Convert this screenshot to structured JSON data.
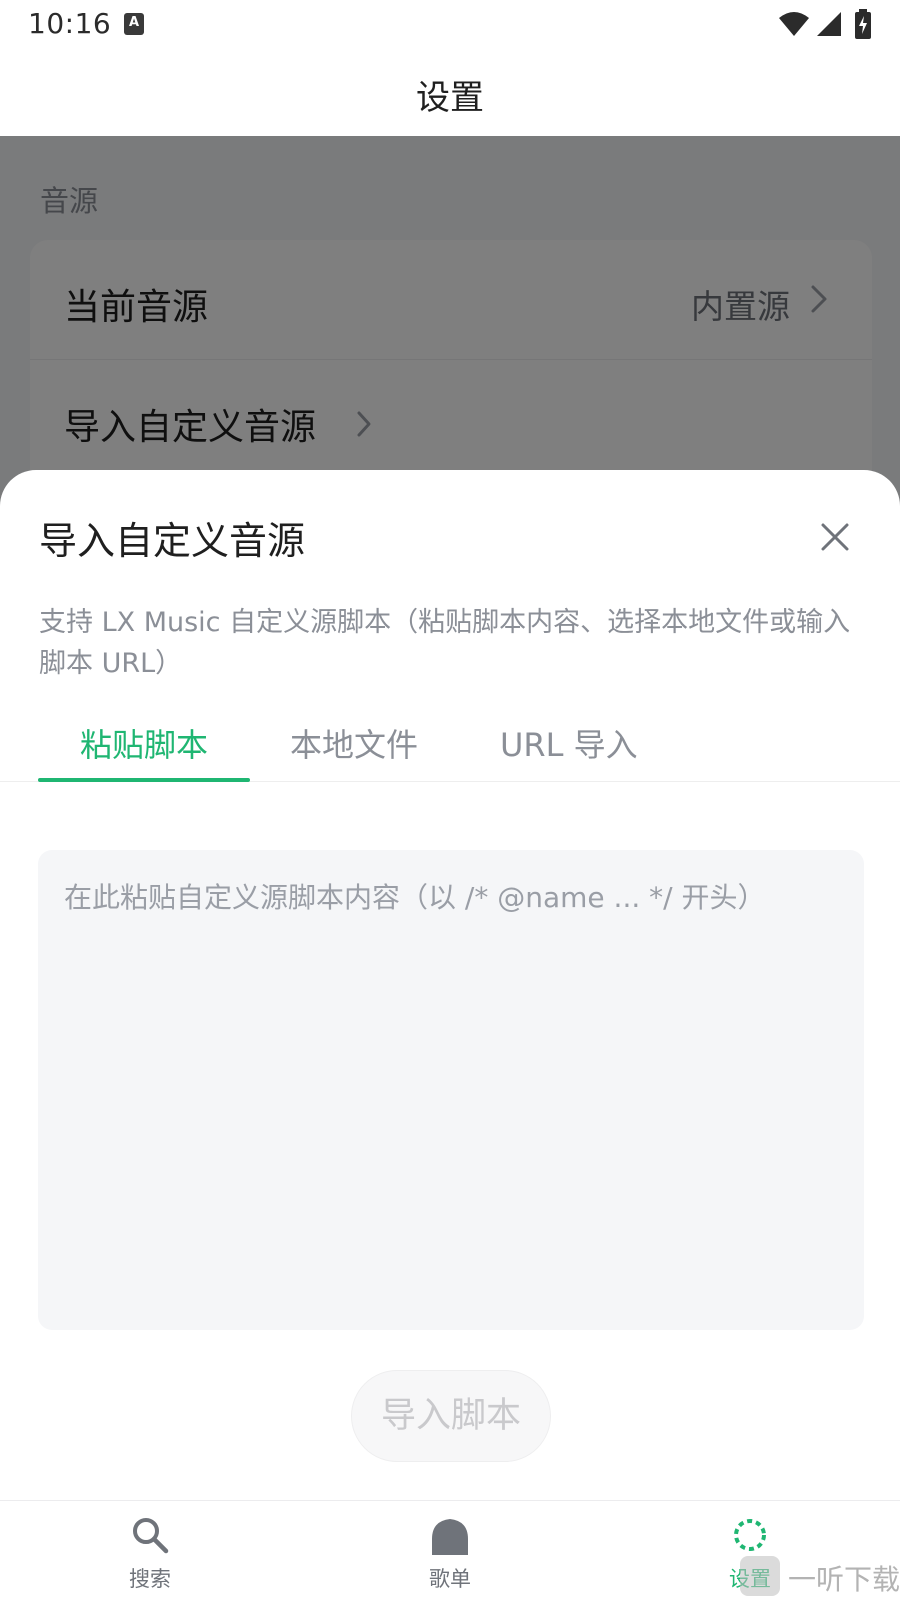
{
  "status_bar": {
    "time": "10:16",
    "notification_icon_letter": "A"
  },
  "header": {
    "title": "设置"
  },
  "settings": {
    "section_label": "音源",
    "rows": [
      {
        "label": "当前音源",
        "value": "内置源"
      },
      {
        "label": "导入自定义音源"
      }
    ]
  },
  "sheet": {
    "title": "导入自定义音源",
    "description": "支持 LX Music 自定义源脚本（粘贴脚本内容、选择本地文件或输入脚本 URL）",
    "tabs": [
      {
        "label": "粘贴脚本",
        "active": true
      },
      {
        "label": "本地文件",
        "active": false
      },
      {
        "label": "URL 导入",
        "active": false
      }
    ],
    "script_placeholder": "在此粘贴自定义源脚本内容（以 /* @name ... */ 开头）",
    "import_button": "导入脚本"
  },
  "bottom_nav": {
    "items": [
      {
        "label": "搜索",
        "icon": "search-icon"
      },
      {
        "label": "歌单",
        "icon": "playlist-icon"
      },
      {
        "label": "设置",
        "icon": "settings-icon",
        "active": true
      }
    ]
  },
  "watermark": {
    "text": "一听下载"
  },
  "colors": {
    "accent": "#1fb672",
    "scrim": "rgba(0,0,0,0.5)",
    "muted_text": "#8b8f97"
  }
}
